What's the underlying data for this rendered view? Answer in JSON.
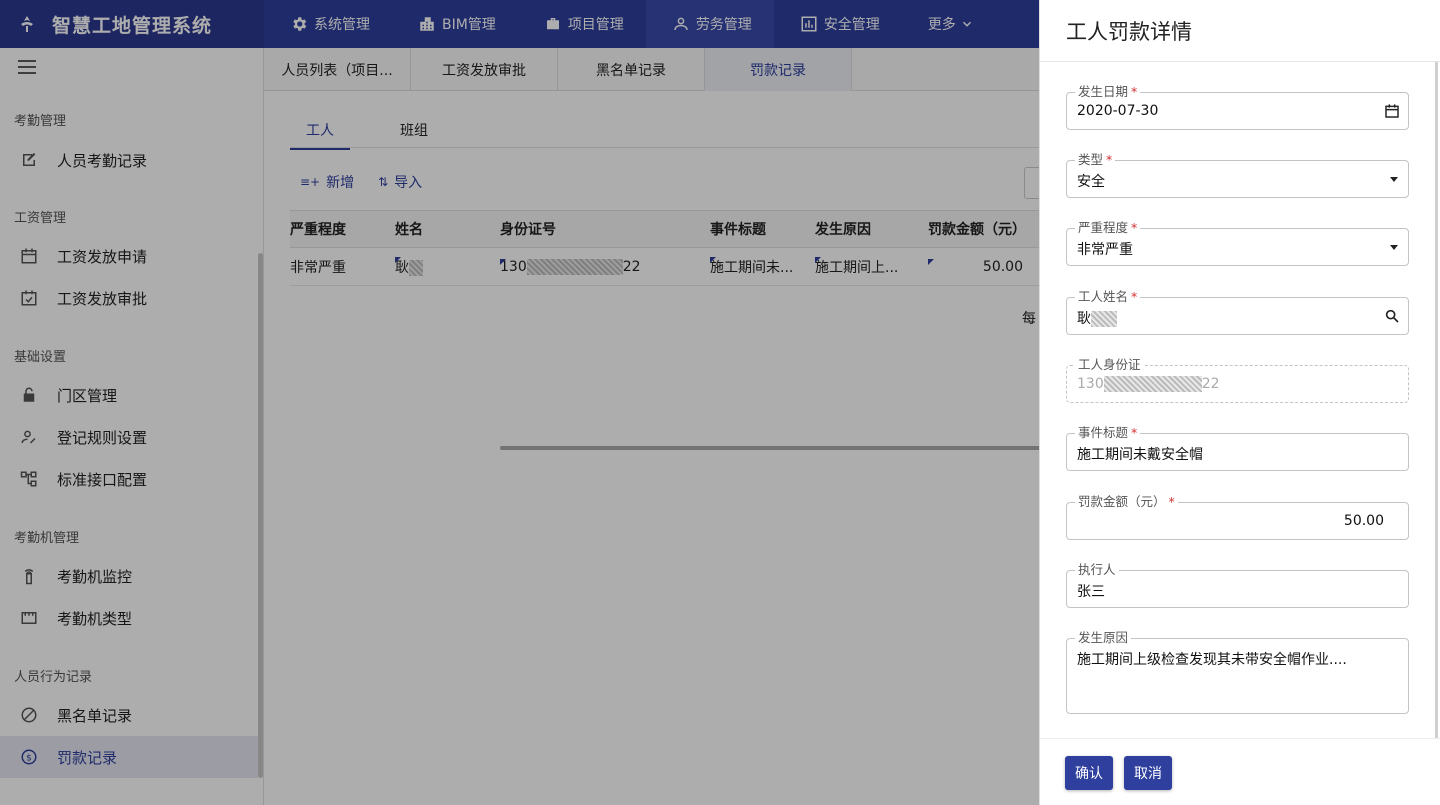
{
  "app": {
    "title": "智慧工地管理系统"
  },
  "topnav": [
    {
      "label": "系统管理",
      "icon": "gear-icon"
    },
    {
      "label": "BIM管理",
      "icon": "building-icon"
    },
    {
      "label": "项目管理",
      "icon": "briefcase-icon"
    },
    {
      "label": "劳务管理",
      "icon": "person-icon",
      "active": true
    },
    {
      "label": "安全管理",
      "icon": "chart-icon"
    },
    {
      "label": "更多",
      "icon": "chevron-down-icon"
    }
  ],
  "sidebar": {
    "sections": [
      "考勤管理",
      "工资管理",
      "基础设置",
      "考勤机管理",
      "人员行为记录"
    ],
    "items": [
      {
        "label": "人员考勤记录",
        "icon": "edit-note-icon"
      },
      {
        "label": "工资发放申请",
        "icon": "calendar-icon"
      },
      {
        "label": "工资发放审批",
        "icon": "calendar-check-icon"
      },
      {
        "label": "门区管理",
        "icon": "lock-icon"
      },
      {
        "label": "登记规则设置",
        "icon": "person-edit-icon"
      },
      {
        "label": "标准接口配置",
        "icon": "tree-icon"
      },
      {
        "label": "考勤机监控",
        "icon": "remote-icon"
      },
      {
        "label": "考勤机类型",
        "icon": "device-icon"
      },
      {
        "label": "黑名单记录",
        "icon": "block-icon"
      },
      {
        "label": "罚款记录",
        "icon": "dollar-icon",
        "active": true
      }
    ]
  },
  "subtabs": [
    "人员列表（项目...",
    "工资发放审批",
    "黑名单记录",
    "罚款记录"
  ],
  "inner_tabs": [
    "工人",
    "班组"
  ],
  "toolbar": {
    "add": "新增",
    "import": "导入"
  },
  "table": {
    "headers": [
      "严重程度",
      "姓名",
      "身份证号",
      "事件标题",
      "发生原因",
      "罚款金额（元）"
    ],
    "row": {
      "severity": "非常严重",
      "name_prefix": "耿",
      "id_prefix": "130",
      "id_suffix": "22",
      "title": "施工期间未...",
      "reason": "施工期间上...",
      "amount": "50.00"
    }
  },
  "pager": {
    "label": "每"
  },
  "drawer": {
    "title": "工人罚款详情",
    "fields": {
      "date": {
        "label": "发生日期",
        "value": "2020-07-30"
      },
      "type": {
        "label": "类型",
        "value": "安全"
      },
      "severity": {
        "label": "严重程度",
        "value": "非常严重"
      },
      "worker": {
        "label": "工人姓名",
        "value": "耿"
      },
      "idcard": {
        "label": "工人身份证",
        "prefix": "130",
        "suffix": "22"
      },
      "title": {
        "label": "事件标题",
        "value": "施工期间未戴安全帽"
      },
      "amount": {
        "label": "罚款金额（元）",
        "value": "50.00"
      },
      "executor": {
        "label": "执行人",
        "value": "张三"
      },
      "reason": {
        "label": "发生原因",
        "value": "施工期间上级检查发现其未带安全帽作业...."
      }
    },
    "confirm": "确认",
    "cancel": "取消",
    "required_mark": "*"
  },
  "colors": {
    "primary": "#2f3f9e",
    "brand_bg": "#2b3990",
    "required": "#d32f2f"
  }
}
